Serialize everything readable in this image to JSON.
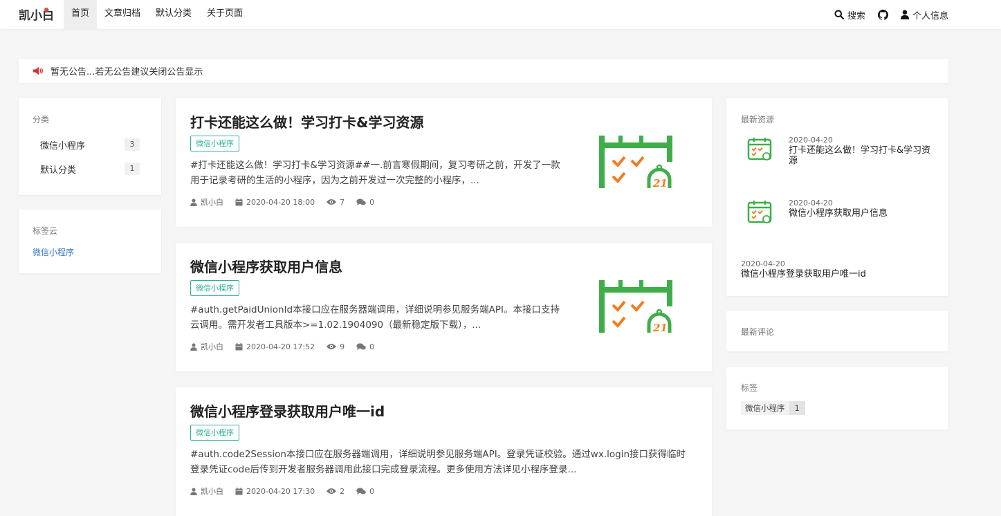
{
  "header": {
    "logo_text": "凯小白",
    "nav": [
      "首页",
      "文章归档",
      "默认分类",
      "关于页面"
    ],
    "search_label": "搜索",
    "profile_label": "个人信息"
  },
  "notice": {
    "text": "暂无公告...若无公告建议关闭公告显示"
  },
  "categories": {
    "title": "分类",
    "items": [
      {
        "label": "微信小程序",
        "count": "3"
      },
      {
        "label": "默认分类",
        "count": "1"
      }
    ]
  },
  "tagcloud": {
    "title": "标签云",
    "items": [
      "微信小程序"
    ]
  },
  "posts": [
    {
      "title": "打卡还能这么做！学习打卡&学习资源",
      "tag": "微信小程序",
      "excerpt": "#打卡还能这么做！学习打卡&学习资源##一.前言寒假期间，复习考研之前，开发了一款用于记录考研的生活的小程序，因为之前开发过一次完整的小程序，...",
      "author": "凯小白",
      "date": "2020-04-20 18:00",
      "views": "7",
      "comments": "0"
    },
    {
      "title": "微信小程序获取用户信息",
      "tag": "微信小程序",
      "excerpt": "#auth.getPaidUnionId本接口应在服务器端调用，详细说明参见服务端API。本接口支持云调用。需开发者工具版本>=1.02.1904090（最新稳定版下载），...",
      "author": "凯小白",
      "date": "2020-04-20 17:52",
      "views": "9",
      "comments": "0"
    },
    {
      "title": "微信小程序登录获取用户唯一id",
      "tag": "微信小程序",
      "excerpt": "#auth.code2Session本接口应在服务器端调用，详细说明参见服务端API。登录凭证校验。通过wx.login接口获得临时登录凭证code后传到开发者服务器调用此接口完成登录流程。更多使用方法详见小程序登录...",
      "author": "凯小白",
      "date": "2020-04-20 17:30",
      "views": "2",
      "comments": "0"
    }
  ],
  "latest_resources": {
    "title": "最新资源",
    "items": [
      {
        "date": "2020-04-20",
        "title": "打卡还能这么做！学习打卡&学习资源"
      },
      {
        "date": "2020-04-20",
        "title": "微信小程序获取用户信息"
      },
      {
        "date": "2020-04-20",
        "title": "微信小程序登录获取用户唯一id"
      }
    ]
  },
  "latest_comments": {
    "title": "最新评论"
  },
  "tags": {
    "title": "标签",
    "items": [
      {
        "name": "微信小程序",
        "count": "1"
      }
    ]
  },
  "colors": {
    "accent_green": "#3fae49",
    "check_orange": "#f47b20",
    "tag_teal": "#2fb09a",
    "link_blue": "#3a75c4",
    "notice_red": "#d9302c"
  }
}
